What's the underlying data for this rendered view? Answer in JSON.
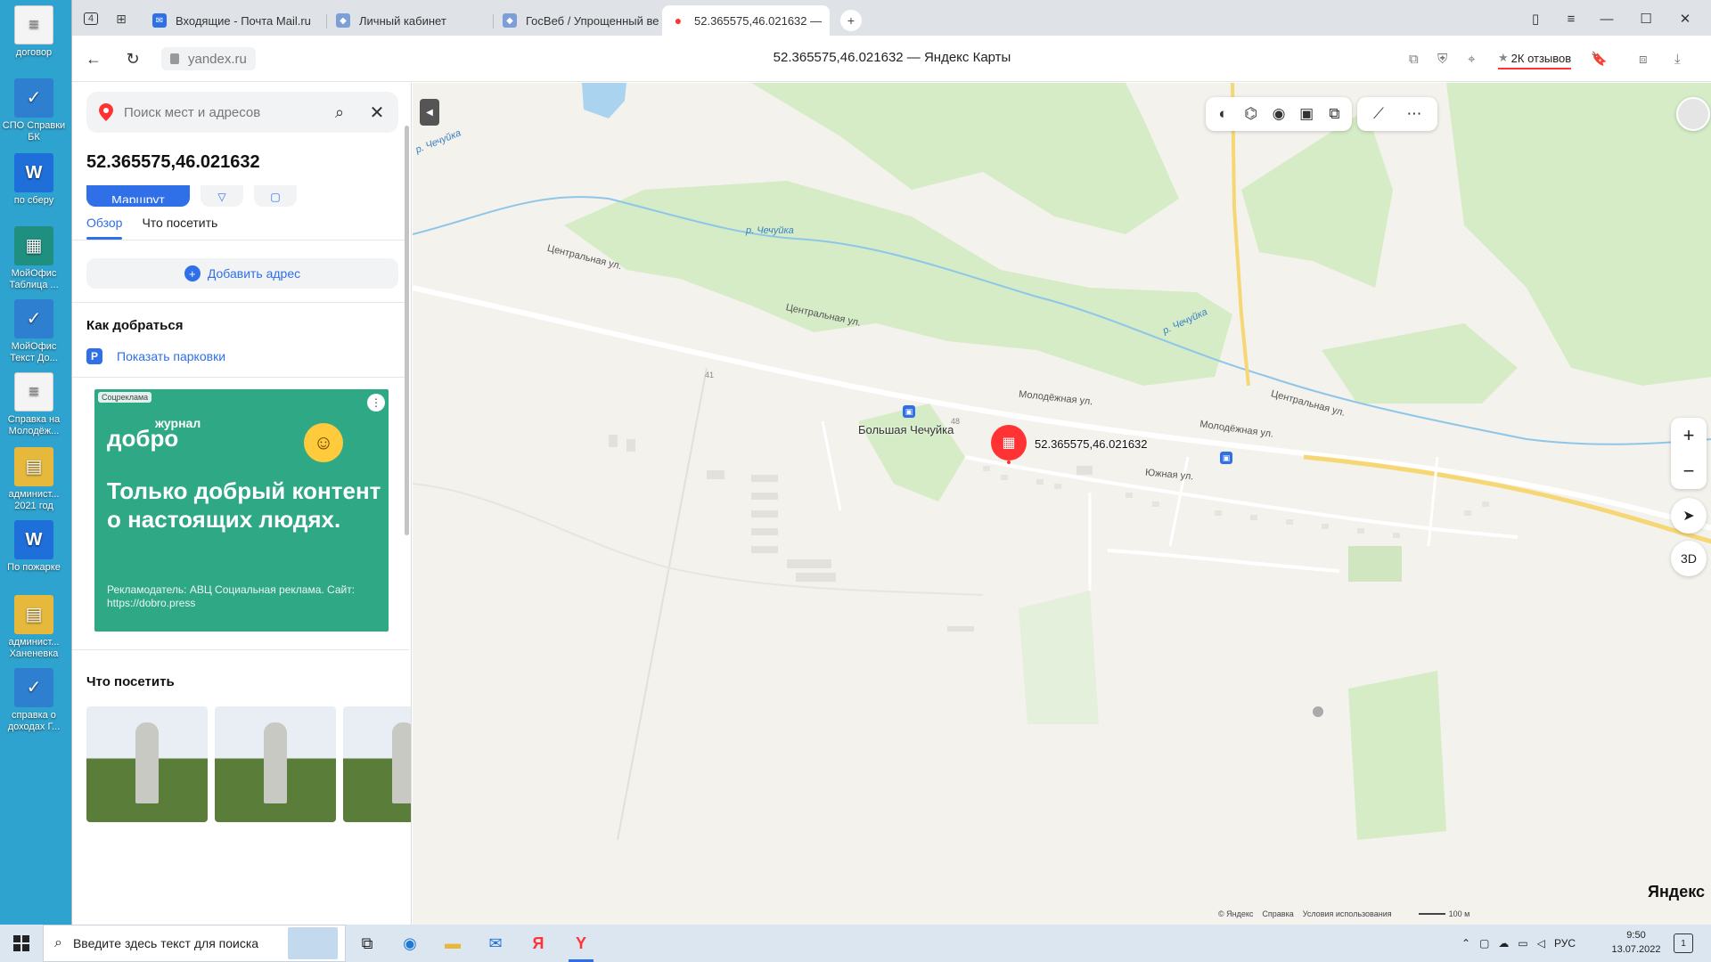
{
  "desktop": {
    "icons": [
      {
        "label": "договор",
        "kind": "doc"
      },
      {
        "label": "СПО Справки БК",
        "kind": "app2"
      },
      {
        "label": "по сберу",
        "kind": "word"
      },
      {
        "label": "МойОфис Таблица ...",
        "kind": "app"
      },
      {
        "label": "МойОфис Текст До...",
        "kind": "app2"
      },
      {
        "label": "Справка на Молодёж...",
        "kind": "doc"
      },
      {
        "label": "админист... 2021 год",
        "kind": "folder"
      },
      {
        "label": "По пожарке",
        "kind": "word"
      },
      {
        "label": "админист... Ханеневка",
        "kind": "folder"
      },
      {
        "label": "справка о доходах Г...",
        "kind": "app2"
      }
    ]
  },
  "browser": {
    "tab_count_badge": "4",
    "tabs": [
      {
        "title": "Входящие - Почта Mail.ru",
        "active": false
      },
      {
        "title": "Личный кабинет",
        "active": false
      },
      {
        "title": "ГосВеб / Упрощенный ве",
        "active": false
      },
      {
        "title": "52.365575,46.021632 —",
        "active": true
      }
    ],
    "url": "yandex.ru",
    "page_title": "52.365575,46.021632 — Яндекс Карты",
    "reviews_label": "2К отзывов",
    "accent": "#2f6fe7",
    "marker_color": "#ff3333"
  },
  "panel": {
    "search_placeholder": "Поиск мест и адресов",
    "coordinates": "52.365575,46.021632",
    "route_label": "Маршрут",
    "tabs": [
      "Обзор",
      "Что посетить"
    ],
    "add_address": "Добавить адрес",
    "how_to_get": "Как добраться",
    "parking_label": "Показать парковки",
    "ad": {
      "tag": "Соцреклама",
      "logo_small": "журнал",
      "logo": "добро",
      "headline": "Только добрый контент о настоящих людях.",
      "fine_print": "Рекламодатель: АВЦ Социальная реклама. Сайт: https://dobro.press"
    },
    "what_to_visit": "Что посетить"
  },
  "map": {
    "marker_label": "52.365575,46.021632",
    "village": "Большая Чечуйка",
    "streets": [
      {
        "name": "Центральная ул."
      },
      {
        "name": "Центральная ул."
      },
      {
        "name": "Центральная ул."
      },
      {
        "name": "Молодёжная ул."
      },
      {
        "name": "Молодёжная ул."
      },
      {
        "name": "Южная ул."
      }
    ],
    "rivers": [
      {
        "name": "р. Чечуйка"
      },
      {
        "name": "р. Чечуйка"
      },
      {
        "name": "р. Чечуйка"
      }
    ],
    "house_numbers": [
      "41",
      "48"
    ],
    "btn_3d": "3D",
    "logo": "Яндекс",
    "footer": {
      "copyright": "© Яндекс",
      "help": "Справка",
      "terms": "Условия использования",
      "scale": "100 м"
    }
  },
  "taskbar": {
    "search_placeholder": "Введите здесь текст для поиска",
    "lang": "РУС",
    "time": "9:50",
    "date": "13.07.2022",
    "notifications": "1"
  }
}
